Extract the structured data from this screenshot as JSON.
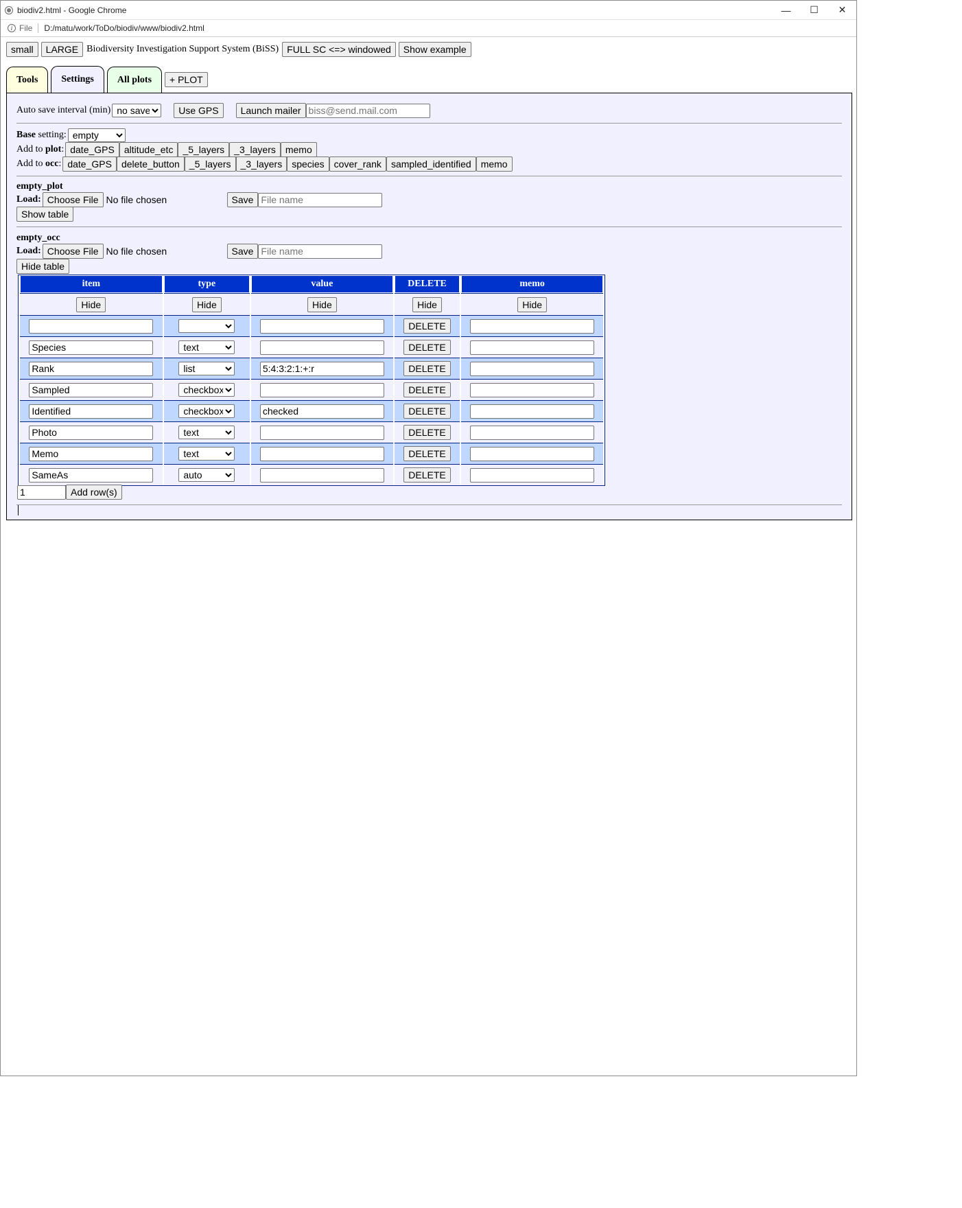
{
  "window": {
    "title": "biodiv2.html - Google Chrome",
    "controls": {
      "minimize": "—",
      "maximize": "☐",
      "close": "✕"
    }
  },
  "address": {
    "scheme": "File",
    "url": "D:/matu/work/ToDo/biodiv/www/biodiv2.html"
  },
  "topbar": {
    "small": "small",
    "large": "LARGE",
    "title": "Biodiversity Investigation Support System (BiSS)",
    "fullsc": "FULL SC <=> windowed",
    "example": "Show example"
  },
  "tabs": {
    "tools": "Tools",
    "settings": "Settings",
    "allplots": "All plots",
    "plus": "+ PLOT"
  },
  "settings": {
    "autosave_label": "Auto save interval (min)",
    "autosave_value": "no save",
    "gps": "Use GPS",
    "mailer": "Launch mailer",
    "mail_placeholder": "biss@send.mail.com",
    "base_bold": "Base",
    "base_rest": " setting:",
    "base_value": "empty",
    "addplot_pre": "Add to ",
    "addplot_bold": "plot",
    "addplot_post": ":",
    "plot_buttons": [
      "date_GPS",
      "altitude_etc",
      "_5_layers",
      "_3_layers",
      "memo"
    ],
    "addocc_pre": "Add to ",
    "addocc_bold": "occ",
    "addocc_post": ":",
    "occ_buttons": [
      "date_GPS",
      "delete_button",
      "_5_layers",
      "_3_layers",
      "species",
      "cover_rank",
      "sampled_identified",
      "memo"
    ]
  },
  "plot_section": {
    "name": "empty_plot",
    "load": "Load:",
    "choose": "Choose File",
    "nofile": "No file chosen",
    "save": "Save",
    "file_placeholder": "File name",
    "table_toggle": "Show table"
  },
  "occ_section": {
    "name": "empty_occ",
    "load": "Load:",
    "choose": "Choose File",
    "nofile": "No file chosen",
    "save": "Save",
    "file_placeholder": "File name",
    "table_toggle": "Hide table"
  },
  "grid": {
    "headers": [
      "item",
      "type",
      "value",
      "DELETE",
      "memo"
    ],
    "hide": "Hide",
    "delete": "DELETE",
    "rows": [
      {
        "item": "",
        "type": "",
        "value": ""
      },
      {
        "item": "Species",
        "type": "text",
        "value": ""
      },
      {
        "item": "Rank",
        "type": "list",
        "value": "5:4:3:2:1:+:r"
      },
      {
        "item": "Sampled",
        "type": "checkbox",
        "value": ""
      },
      {
        "item": "Identified",
        "type": "checkbox",
        "value": "checked"
      },
      {
        "item": "Photo",
        "type": "text",
        "value": ""
      },
      {
        "item": "Memo",
        "type": "text",
        "value": ""
      },
      {
        "item": "SameAs",
        "type": "auto",
        "value": ""
      }
    ]
  },
  "addrows": {
    "count": "1",
    "label": "Add row(s)"
  }
}
